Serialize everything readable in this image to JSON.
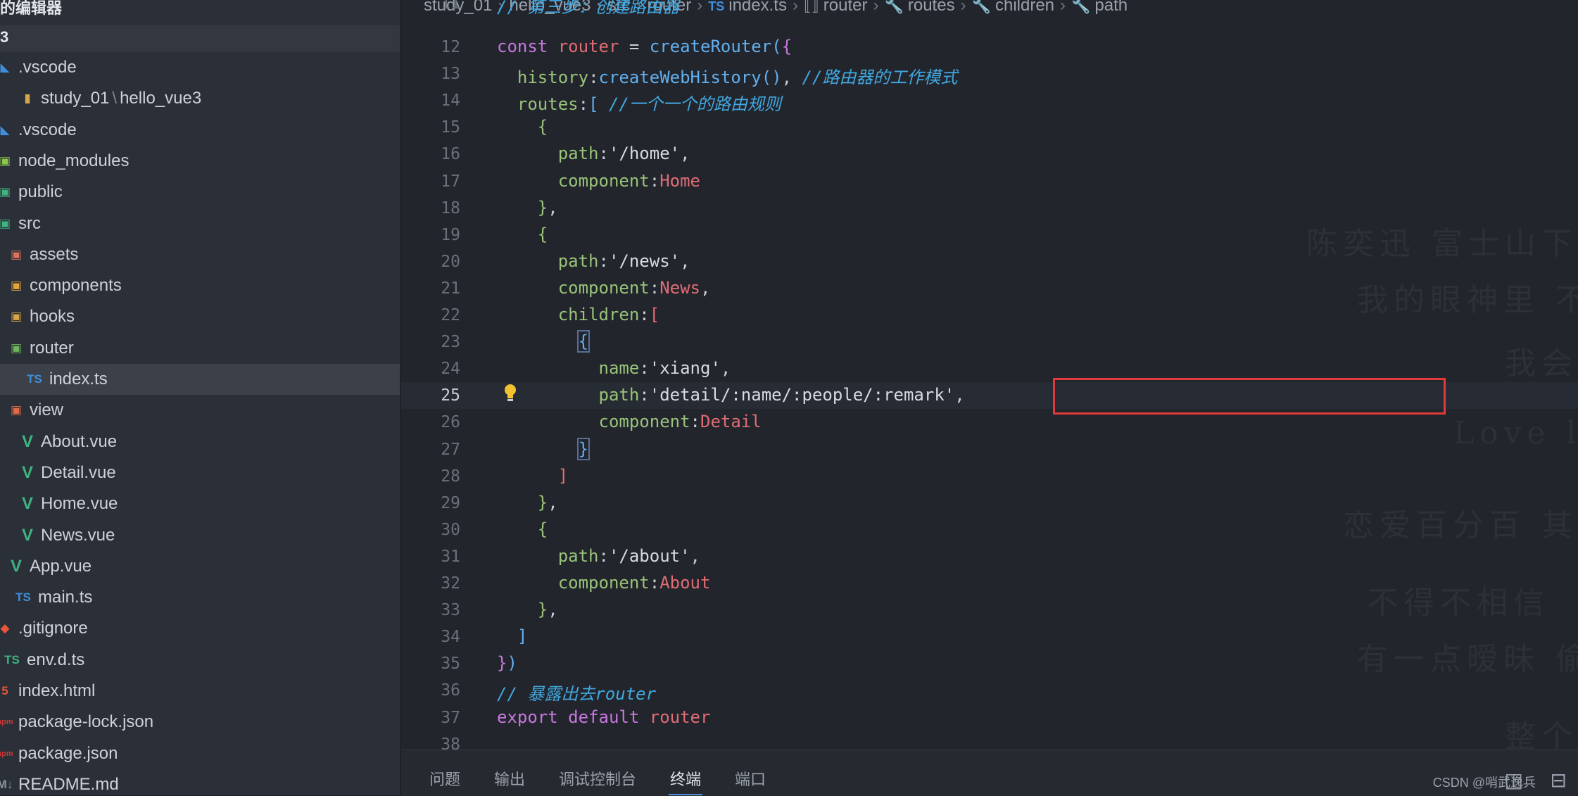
{
  "sidebar": {
    "title": "的编辑器",
    "root": "3",
    "items": [
      {
        "label": ".vscode",
        "icon": "vscode-folder-icon",
        "glyph": "◣",
        "color": "#3d8fdb"
      },
      {
        "label_parts": [
          "study_01",
          "\\",
          "hello_vue3"
        ],
        "icon": "folder-icon",
        "glyph": "▮",
        "color": "#d8a64a"
      },
      {
        "label": ".vscode",
        "icon": "vscode-folder-icon",
        "glyph": "◣",
        "color": "#3d8fdb"
      },
      {
        "label": "node_modules",
        "icon": "node-modules-folder-icon",
        "glyph": "▣",
        "color": "#8cc84b"
      },
      {
        "label": "public",
        "icon": "public-folder-icon",
        "glyph": "▣",
        "color": "#3fb27f"
      },
      {
        "label": "src",
        "icon": "src-folder-icon",
        "glyph": "▣",
        "color": "#3fb27f"
      },
      {
        "label": "assets",
        "icon": "assets-folder-icon",
        "glyph": "▣",
        "color": "#d8725e"
      },
      {
        "label": "components",
        "icon": "components-folder-icon",
        "glyph": "▣",
        "color": "#e6a43a"
      },
      {
        "label": "hooks",
        "icon": "hooks-folder-icon",
        "glyph": "▣",
        "color": "#d8a64a"
      },
      {
        "label": "router",
        "icon": "router-folder-icon",
        "glyph": "▣",
        "color": "#6fb35e"
      },
      {
        "label": "index.ts",
        "icon": "typescript-file-icon",
        "glyph": "TS",
        "color": "#3d8fdb",
        "selected": true
      },
      {
        "label": "view",
        "icon": "view-folder-icon",
        "glyph": "▣",
        "color": "#e06c4a"
      },
      {
        "label": "About.vue",
        "icon": "vue-file-icon",
        "glyph": "V",
        "color": "#3fb27f"
      },
      {
        "label": "Detail.vue",
        "icon": "vue-file-icon",
        "glyph": "V",
        "color": "#3fb27f"
      },
      {
        "label": "Home.vue",
        "icon": "vue-file-icon",
        "glyph": "V",
        "color": "#3fb27f"
      },
      {
        "label": "News.vue",
        "icon": "vue-file-icon",
        "glyph": "V",
        "color": "#3fb27f"
      },
      {
        "label": "App.vue",
        "icon": "vue-file-icon",
        "glyph": "V",
        "color": "#3fb27f"
      },
      {
        "label": "main.ts",
        "icon": "typescript-file-icon",
        "glyph": "TS",
        "color": "#3d8fdb"
      },
      {
        "label": ".gitignore",
        "icon": "git-icon",
        "glyph": "◆",
        "color": "#e8553a"
      },
      {
        "label": "env.d.ts",
        "icon": "typescript-def-icon",
        "glyph": "TS",
        "color": "#3fb27f"
      },
      {
        "label": "index.html",
        "icon": "html5-icon",
        "glyph": "5",
        "color": "#e8553a"
      },
      {
        "label": "package-lock.json",
        "icon": "npm-icon",
        "glyph": "npm",
        "color": "#cb3837"
      },
      {
        "label": "package.json",
        "icon": "npm-icon",
        "glyph": "npm",
        "color": "#cb3837"
      },
      {
        "label": "README.md",
        "icon": "markdown-icon",
        "glyph": "M↓",
        "color": "#8b93a0"
      }
    ]
  },
  "breadcrumb": [
    {
      "label": "study_01"
    },
    {
      "label": "hello_vue3"
    },
    {
      "label": "src"
    },
    {
      "label": "router"
    },
    {
      "label": "index.ts",
      "icon": "TS"
    },
    {
      "label": "router",
      "icon": "⟦⟧"
    },
    {
      "label": "routes",
      "icon": "🔧"
    },
    {
      "label": "children",
      "icon": "🔧"
    },
    {
      "label": "path",
      "icon": "🔧"
    }
  ],
  "editor": {
    "partial_top_line": {
      "num": "11",
      "text": "// 第三步：创建路由器"
    },
    "lines": [
      {
        "num": "12",
        "tokens": [
          [
            "kw",
            "const "
          ],
          [
            "var",
            "router"
          ],
          [
            "pun",
            " = "
          ],
          [
            "fn",
            "createRouter"
          ],
          [
            "br2",
            "("
          ],
          [
            "br1",
            "{"
          ]
        ]
      },
      {
        "num": "13",
        "tokens": [
          [
            "pun",
            "  "
          ],
          [
            "prop",
            "history"
          ],
          [
            "pun",
            ":"
          ],
          [
            "fn",
            "createWebHistory"
          ],
          [
            "br2",
            "()"
          ],
          [
            "pun",
            ", "
          ],
          [
            "cmt",
            "//路由器的工作模式"
          ]
        ]
      },
      {
        "num": "14",
        "tokens": [
          [
            "pun",
            "  "
          ],
          [
            "prop",
            "routes"
          ],
          [
            "pun",
            ":"
          ],
          [
            "br2",
            "["
          ],
          [
            "pun",
            " "
          ],
          [
            "cmt",
            "//一个一个的路由规则"
          ]
        ]
      },
      {
        "num": "15",
        "tokens": [
          [
            "pun",
            "    "
          ],
          [
            "br3",
            "{"
          ]
        ]
      },
      {
        "num": "16",
        "tokens": [
          [
            "pun",
            "      "
          ],
          [
            "prop",
            "path"
          ],
          [
            "pun",
            ":"
          ],
          [
            "str",
            "'/home'"
          ],
          [
            "pun",
            ","
          ]
        ]
      },
      {
        "num": "17",
        "tokens": [
          [
            "pun",
            "      "
          ],
          [
            "prop",
            "component"
          ],
          [
            "pun",
            ":"
          ],
          [
            "var",
            "Home"
          ]
        ]
      },
      {
        "num": "18",
        "tokens": [
          [
            "pun",
            "    "
          ],
          [
            "br3",
            "}"
          ],
          [
            "pun",
            ","
          ]
        ]
      },
      {
        "num": "19",
        "tokens": [
          [
            "pun",
            "    "
          ],
          [
            "br3",
            "{"
          ]
        ]
      },
      {
        "num": "20",
        "tokens": [
          [
            "pun",
            "      "
          ],
          [
            "prop",
            "path"
          ],
          [
            "pun",
            ":"
          ],
          [
            "str",
            "'/news'"
          ],
          [
            "pun",
            ","
          ]
        ]
      },
      {
        "num": "21",
        "tokens": [
          [
            "pun",
            "      "
          ],
          [
            "prop",
            "component"
          ],
          [
            "pun",
            ":"
          ],
          [
            "var",
            "News"
          ],
          [
            "pun",
            ","
          ]
        ]
      },
      {
        "num": "22",
        "tokens": [
          [
            "pun",
            "      "
          ],
          [
            "prop",
            "children"
          ],
          [
            "pun",
            ":"
          ],
          [
            "br4",
            "["
          ]
        ]
      },
      {
        "num": "23",
        "tokens": [
          [
            "pun",
            "        "
          ],
          [
            "br3box",
            "{"
          ]
        ]
      },
      {
        "num": "24",
        "tokens": [
          [
            "pun",
            "          "
          ],
          [
            "prop",
            "name"
          ],
          [
            "pun",
            ":"
          ],
          [
            "str",
            "'xiang'"
          ],
          [
            "pun",
            ","
          ]
        ]
      },
      {
        "num": "25",
        "tokens": [
          [
            "pun",
            "          "
          ],
          [
            "prop",
            "path"
          ],
          [
            "pun",
            ":"
          ],
          [
            "str",
            "'detail/:name/:people/:remark'"
          ],
          [
            "pun",
            ","
          ]
        ],
        "current": true
      },
      {
        "num": "26",
        "tokens": [
          [
            "pun",
            "          "
          ],
          [
            "prop",
            "component"
          ],
          [
            "pun",
            ":"
          ],
          [
            "var",
            "Detail"
          ]
        ]
      },
      {
        "num": "27",
        "tokens": [
          [
            "pun",
            "        "
          ],
          [
            "br3box",
            "}"
          ]
        ]
      },
      {
        "num": "28",
        "tokens": [
          [
            "pun",
            "      "
          ],
          [
            "br4",
            "]"
          ]
        ]
      },
      {
        "num": "29",
        "tokens": [
          [
            "pun",
            "    "
          ],
          [
            "br3",
            "}"
          ],
          [
            "pun",
            ","
          ]
        ]
      },
      {
        "num": "30",
        "tokens": [
          [
            "pun",
            "    "
          ],
          [
            "br3",
            "{"
          ]
        ]
      },
      {
        "num": "31",
        "tokens": [
          [
            "pun",
            "      "
          ],
          [
            "prop",
            "path"
          ],
          [
            "pun",
            ":"
          ],
          [
            "str",
            "'/about'"
          ],
          [
            "pun",
            ","
          ]
        ]
      },
      {
        "num": "32",
        "tokens": [
          [
            "pun",
            "      "
          ],
          [
            "prop",
            "component"
          ],
          [
            "pun",
            ":"
          ],
          [
            "var",
            "About"
          ]
        ]
      },
      {
        "num": "33",
        "tokens": [
          [
            "pun",
            "    "
          ],
          [
            "br3",
            "}"
          ],
          [
            "pun",
            ","
          ]
        ]
      },
      {
        "num": "34",
        "tokens": [
          [
            "pun",
            "  "
          ],
          [
            "br2",
            "]"
          ]
        ]
      },
      {
        "num": "35",
        "tokens": [
          [
            "br1",
            "}"
          ],
          [
            "br2",
            ")"
          ]
        ]
      },
      {
        "num": "36",
        "tokens": [
          [
            "cmt",
            "// 暴露出去router"
          ]
        ]
      },
      {
        "num": "37",
        "tokens": [
          [
            "kw",
            "export "
          ],
          [
            "kw",
            "default "
          ],
          [
            "var",
            "router"
          ]
        ]
      },
      {
        "num": "38",
        "tokens": []
      }
    ]
  },
  "background_text": [
    "陈奕迅 富士山下",
    "我的眼神里 不",
    "我会",
    "Love lo",
    "恋爱百分百 其",
    "不得不相信",
    "有一点暧昧 偷",
    "整个"
  ],
  "panel": {
    "tabs": [
      {
        "label": "问题"
      },
      {
        "label": "输出"
      },
      {
        "label": "调试控制台"
      },
      {
        "label": "终端",
        "active": true
      },
      {
        "label": "端口"
      }
    ],
    "watermark": "CSDN @哨武逸兵"
  }
}
